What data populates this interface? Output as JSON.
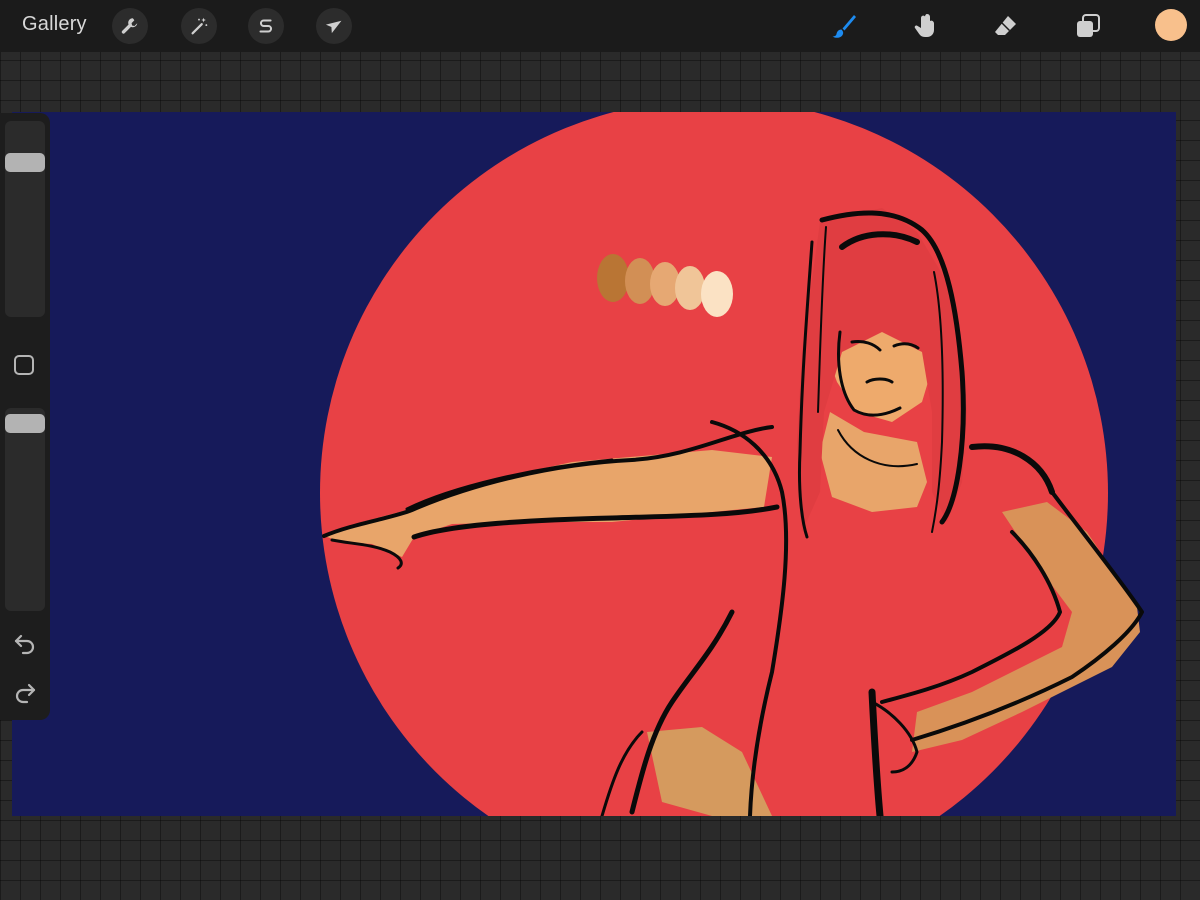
{
  "toolbar": {
    "gallery_label": "Gallery",
    "left_tools": [
      {
        "name": "actions",
        "icon": "wrench-icon"
      },
      {
        "name": "adjustments",
        "icon": "magic-wand-icon"
      },
      {
        "name": "selection",
        "icon": "selection-s-icon"
      },
      {
        "name": "transform",
        "icon": "arrow-cursor-icon"
      }
    ],
    "right_tools": [
      {
        "name": "brush",
        "icon": "brush-icon",
        "active": true
      },
      {
        "name": "smudge",
        "icon": "smudge-finger-icon",
        "active": false
      },
      {
        "name": "eraser",
        "icon": "eraser-icon",
        "active": false
      },
      {
        "name": "layers",
        "icon": "layers-icon",
        "active": false
      }
    ],
    "current_color": "#f8c08c",
    "active_color": "#1d8bf0"
  },
  "sidebar": {
    "brush_size_level": 0.82,
    "opacity_level": 0.97,
    "icons": [
      "modify-square-icon",
      "undo-icon",
      "redo-icon"
    ]
  },
  "canvas": {
    "background_color": "#161a5a",
    "circle_color": "#e84145",
    "palette_swatches": [
      "#b97534",
      "#d28f55",
      "#e6a873",
      "#f0c598",
      "#fbe2c4"
    ]
  }
}
